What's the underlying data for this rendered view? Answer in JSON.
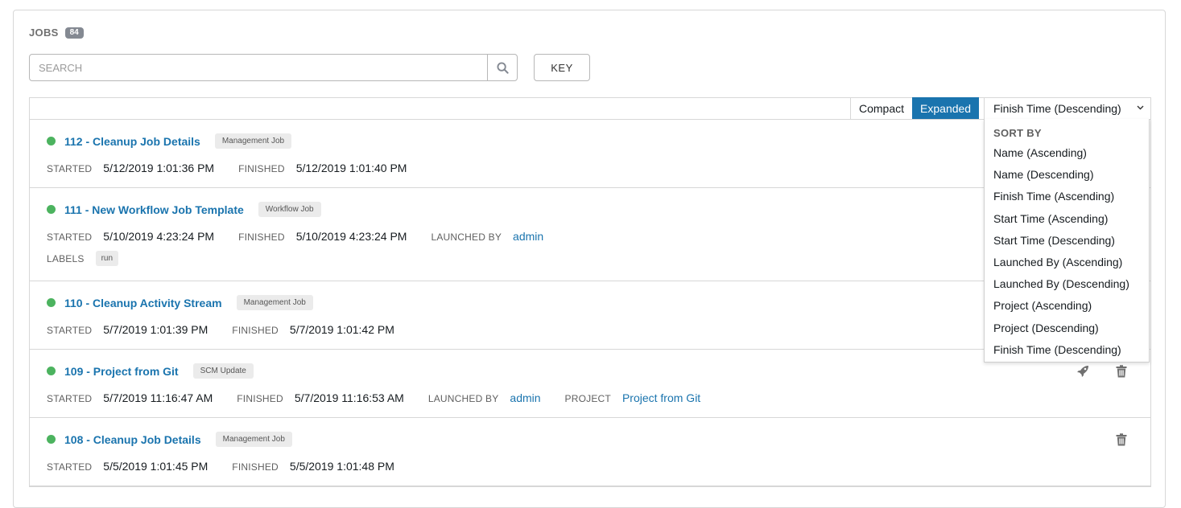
{
  "header": {
    "title": "JOBS",
    "count": "84"
  },
  "search": {
    "placeholder": "SEARCH"
  },
  "key_button": "KEY",
  "view_toggle": {
    "compact": "Compact",
    "expanded": "Expanded"
  },
  "sort": {
    "selected": "Finish Time (Descending)",
    "header": "SORT BY",
    "options": [
      "Name (Ascending)",
      "Name (Descending)",
      "Finish Time (Ascending)",
      "Start Time (Ascending)",
      "Start Time (Descending)",
      "Launched By (Ascending)",
      "Launched By (Descending)",
      "Project (Ascending)",
      "Project (Descending)",
      "Finish Time (Descending)"
    ]
  },
  "field_labels": {
    "started": "STARTED",
    "finished": "FINISHED",
    "launched_by": "LAUNCHED BY",
    "project": "PROJECT",
    "labels": "LABELS"
  },
  "jobs": [
    {
      "name": "112 - Cleanup Job Details",
      "type": "Management Job",
      "status": "successful",
      "started": "5/12/2019 1:01:36 PM",
      "finished": "5/12/2019 1:01:40 PM"
    },
    {
      "name": "111 - New Workflow Job Template",
      "type": "Workflow Job",
      "status": "successful",
      "started": "5/10/2019 4:23:24 PM",
      "finished": "5/10/2019 4:23:24 PM",
      "launched_by": "admin",
      "labels": [
        "run"
      ]
    },
    {
      "name": "110 - Cleanup Activity Stream",
      "type": "Management Job",
      "status": "successful",
      "started": "5/7/2019 1:01:39 PM",
      "finished": "5/7/2019 1:01:42 PM"
    },
    {
      "name": "109 - Project from Git",
      "type": "SCM Update",
      "status": "successful",
      "started": "5/7/2019 11:16:47 AM",
      "finished": "5/7/2019 11:16:53 AM",
      "launched_by": "admin",
      "project": "Project from Git"
    },
    {
      "name": "108 - Cleanup Job Details",
      "type": "Management Job",
      "status": "successful",
      "started": "5/5/2019 1:01:45 PM",
      "finished": "5/5/2019 1:01:48 PM"
    }
  ],
  "colors": {
    "accent": "#1a74ae",
    "success": "#4cb35f"
  },
  "icons": {
    "search": "search-icon",
    "chevron": "chevron-down-icon",
    "relaunch": "rocket-icon",
    "delete": "trash-icon"
  }
}
